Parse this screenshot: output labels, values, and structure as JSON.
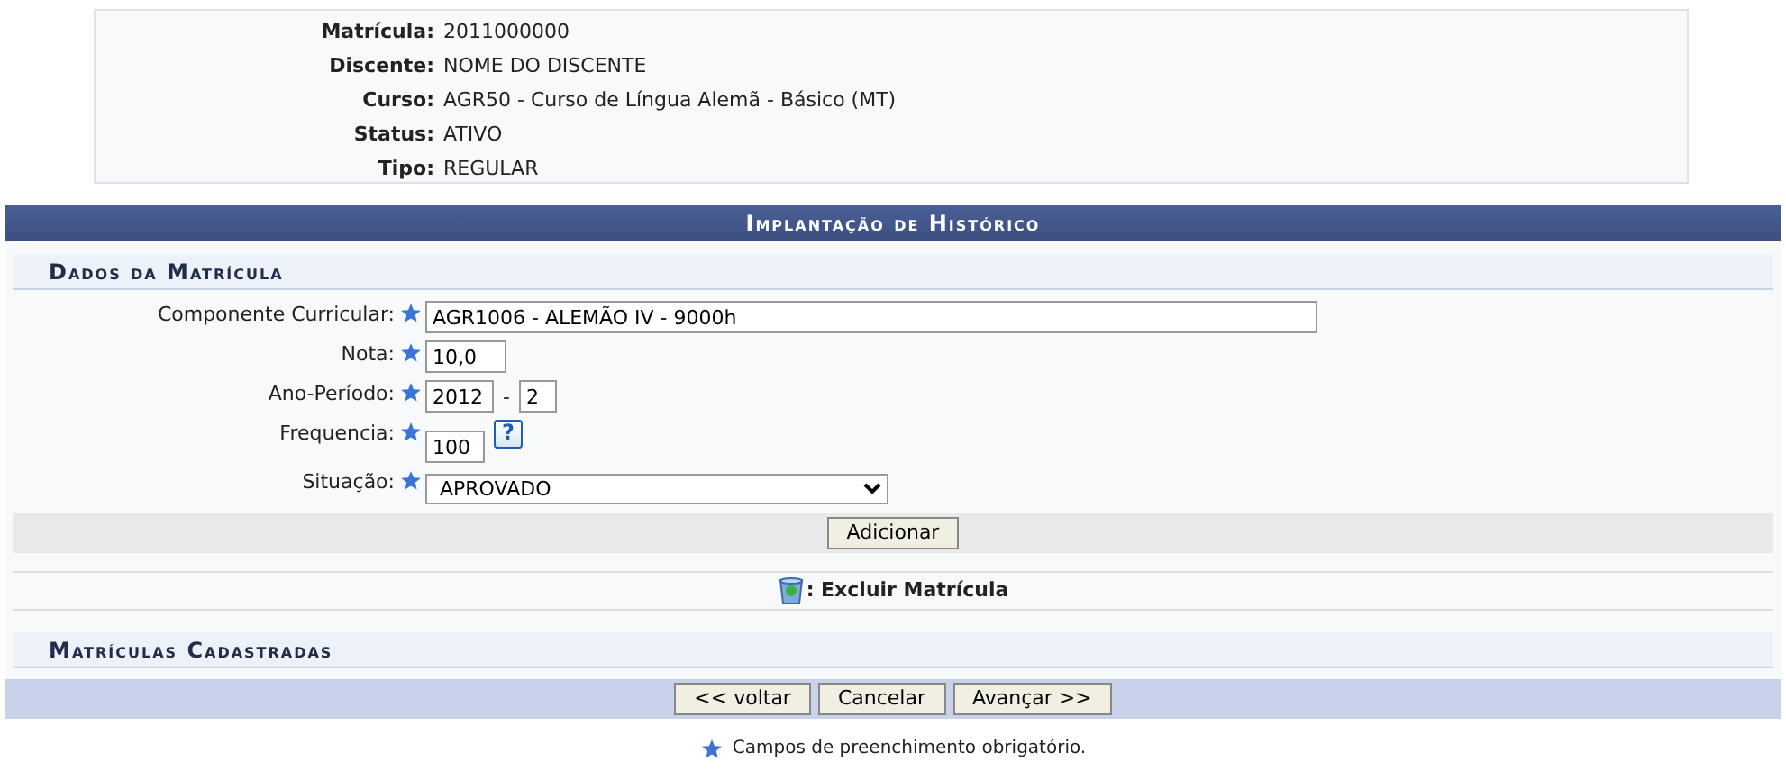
{
  "info": [
    {
      "label": "Matrícula:",
      "value": "2011000000"
    },
    {
      "label": "Discente:",
      "value": "NOME DO DISCENTE"
    },
    {
      "label": "Curso:",
      "value": "AGR50 - Curso de Língua Alemã - Básico (MT)"
    },
    {
      "label": "Status:",
      "value": "ATIVO"
    },
    {
      "label": "Tipo:",
      "value": "REGULAR"
    }
  ],
  "panel_title": "Implantação de Histórico",
  "section_title": "Dados da Matrícula",
  "fields": [
    {
      "kind": "text",
      "label": "Componente Curricular:",
      "value": "AGR1006 - ALEMÃO IV - 9000h",
      "required": true
    },
    {
      "kind": "short",
      "label": "Nota:",
      "value": "10,0",
      "required": true
    },
    {
      "kind": "period",
      "label": "Ano-Período:",
      "value": "2012",
      "separator": "-",
      "value2": "2",
      "required": true
    },
    {
      "kind": "help",
      "label": "Frequencia:",
      "value": "100",
      "required": true,
      "help": "?"
    },
    {
      "kind": "select",
      "label": "Situação:",
      "value": "APROVADO",
      "required": true
    }
  ],
  "add_button": "Adicionar",
  "legend": ": Excluir Matrícula",
  "list_title": "Matrículas Cadastradas",
  "buttons": [
    "<< voltar",
    "Cancelar",
    "Avançar >>"
  ],
  "footnote": "Campos de preenchimento obrigatório."
}
